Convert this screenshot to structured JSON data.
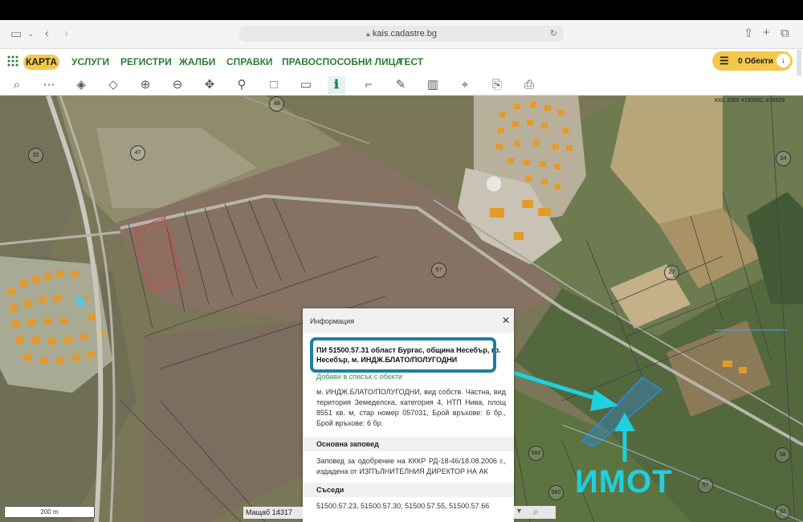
{
  "browser": {
    "url": "kais.cadastre.bg"
  },
  "nav": {
    "items": [
      "КАРТА",
      "УСЛУГИ",
      "РЕГИСТРИ",
      "ЖАЛБИ",
      "СПРАВКИ",
      "ПРАВОСПОСОБНИ ЛИЦА",
      "ТЕСТ"
    ],
    "objects_label": "0 Обекти"
  },
  "toolbar": {
    "tools": [
      "search-icon",
      "nodes-icon",
      "layers-icon",
      "layers-stack-icon",
      "zoom-in-icon",
      "zoom-out-icon",
      "pan-icon",
      "pin-icon",
      "select-rect-icon",
      "deselect-rect-icon",
      "info-icon",
      "measure-icon",
      "draw-icon",
      "map-icon",
      "crosshair-icon",
      "export-icon",
      "print-icon"
    ]
  },
  "map": {
    "crs_label": "ККС 2005 4730392, 678528",
    "parcel_numbers": [
      "48",
      "47",
      "32",
      "57",
      "27",
      "54",
      "580",
      "580",
      "57",
      "58",
      "32"
    ],
    "annotation": "ИМОТ",
    "scale_bar": "200 m",
    "scale_label": "Мащаб 1:",
    "scale_value": "4317",
    "accent": "#1fd0df"
  },
  "panel": {
    "title": "Информация",
    "parcel_title": "ПИ 51500.57.31 област Бургас, община Несебър, гр. Несебър, м. ИНДЖ.БЛАТО/ПОЛУГОДНИ",
    "add_link": "Добави в списък с обекти",
    "details": "м. ИНДЖ.БЛАТО/ПОЛУГОДНИ, вид собств. Частна, вид територия Земеделска, категория 4, НТП Нива, площ 8551 кв. м, стар номер 057031, Брой връхове: 6 бр., Брой връхове: 6 бр.",
    "order_heading": "Основна заповед",
    "order_text": "Заповед за одобрение на КККР РД-18-46/18.08.2006 г., издадена от ИЗПЪЛНИТЕЛНИЯ ДИРЕКТОР НА АК",
    "neighbors_heading": "Съседи",
    "neighbors": "51500.57.23, 51500.57.30, 51500.57.55, 51500.57.66"
  }
}
